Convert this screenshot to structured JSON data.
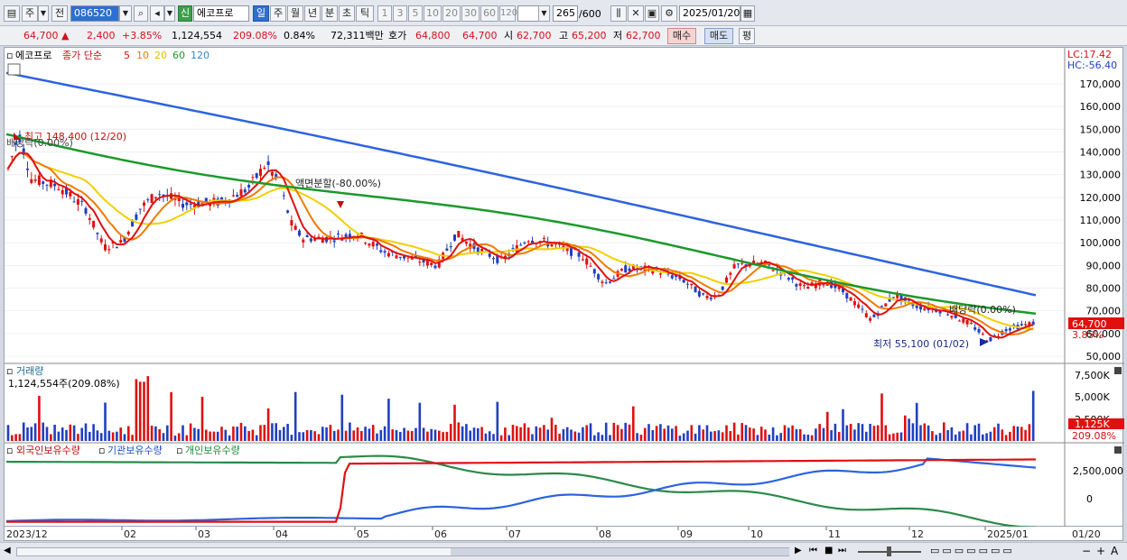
{
  "toolbar": {
    "market": "주",
    "scope": "전",
    "code": "086520",
    "stock_name": "에코프로",
    "new_badge": "신",
    "periods": [
      "일",
      "주",
      "월",
      "년",
      "분",
      "초",
      "틱"
    ],
    "active_period": "일",
    "intervals": [
      "1",
      "3",
      "5",
      "10",
      "20",
      "30",
      "60",
      "120"
    ],
    "count": "265",
    "count_max": "/600",
    "date": "2025/01/20"
  },
  "quote": {
    "price": "64,700",
    "change": "2,400",
    "change_pct": "+3.85%",
    "volume": "1,124,554",
    "volume_ratio": "209.08%",
    "turnover_ratio": "0.84%",
    "amount": "72,311백만",
    "ask_label": "호가",
    "ask": "64,800",
    "bid": "64,700",
    "open_label": "시",
    "open": "62,700",
    "high_label": "고",
    "high": "65,200",
    "low_label": "저",
    "low": "62,700",
    "buy": "매수",
    "sell": "매도",
    "avg": "평"
  },
  "price_panel": {
    "name": "에코프로",
    "ma_title": "종가 단순",
    "ma_periods": [
      "5",
      "10",
      "20",
      "60",
      "120"
    ],
    "lc": "LC:17.42",
    "hc": "HC:-56.40",
    "yticks": [
      "170,000",
      "160,000",
      "150,000",
      "140,000",
      "130,000",
      "120,000",
      "110,000",
      "100,000",
      "90,000",
      "80,000",
      "70,000",
      "60,000",
      "50,000"
    ],
    "last_price": "64,700",
    "last_pct": "3.85%",
    "annotations": {
      "high": "최고 148,400 (12/20)",
      "ex1": "배당락(0.00%)",
      "split": "액면분할(-80.00%)",
      "ex2": "배당락(0.00%)",
      "low": "최저 55,100 (01/02)"
    }
  },
  "volume_panel": {
    "title": "거래량",
    "current": "1,124,554주(209.08%)",
    "yticks": [
      "7,500K",
      "5,000K",
      "2,500K"
    ],
    "last": "1,125K",
    "last_pct": "209.08%"
  },
  "holdings_panel": {
    "legend": [
      "외국인보유수량",
      "기관보유수량",
      "개인보유수량"
    ],
    "yticks": [
      "2,500,000",
      "0"
    ]
  },
  "xaxis": [
    "2023/12",
    "02",
    "03",
    "04",
    "05",
    "06",
    "07",
    "08",
    "09",
    "10",
    "11",
    "12",
    "2025/01",
    "01/20"
  ],
  "colors": {
    "ma5": "#e01010",
    "ma10": "#f07a00",
    "ma20": "#f0d000",
    "ma60": "#1a9a2a",
    "ma120": "#2d63e0",
    "up": "#e01010",
    "down": "#2040c0"
  }
}
